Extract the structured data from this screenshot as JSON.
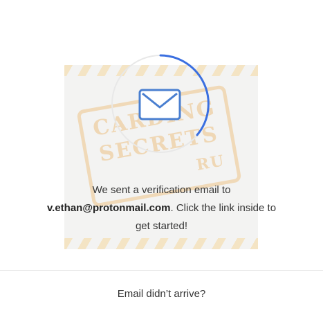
{
  "watermark": {
    "line1": "CARDING",
    "line2": "SECRETS",
    "line3": "RU"
  },
  "verification": {
    "line1": "We sent a verification email to",
    "email": "v.ethan@protonmail.com",
    "line2_rest": ". Click the link inside to",
    "line3": "get started!"
  },
  "footer": {
    "resend_link": "Email didn’t arrive?"
  },
  "colors": {
    "accent": "#3b6fe0",
    "icon": "#4a7fd0"
  },
  "icons": [
    "loading-spinner-icon",
    "envelope-icon"
  ]
}
